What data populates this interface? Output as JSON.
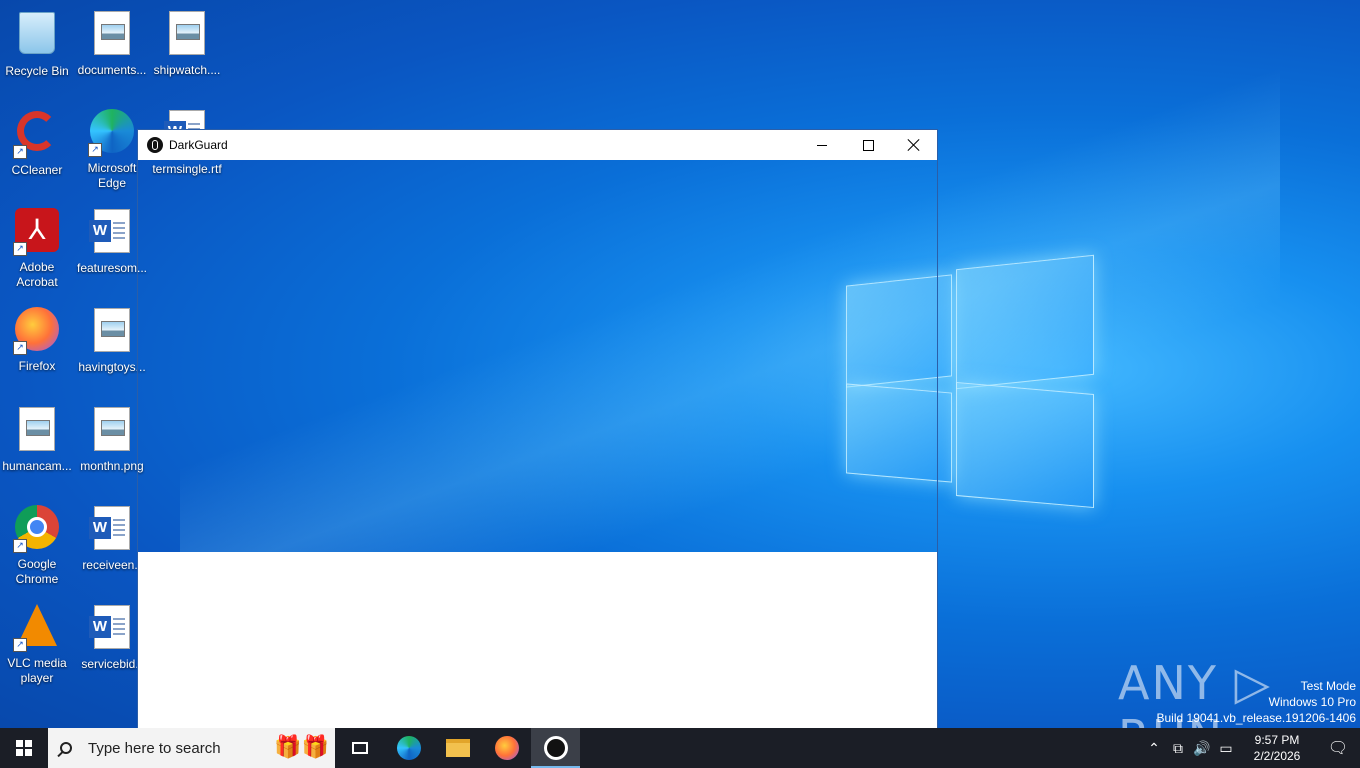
{
  "desktop": {
    "icons": [
      {
        "label": "Recycle Bin"
      },
      {
        "label": "documents..."
      },
      {
        "label": "shipwatch...."
      },
      {
        "label": "CCleaner"
      },
      {
        "label": "Microsoft Edge"
      },
      {
        "label": "termsingle.rtf"
      },
      {
        "label": "Adobe Acrobat"
      },
      {
        "label": "featuresom..."
      },
      {
        "label": "Firefox"
      },
      {
        "label": "havingtoys..."
      },
      {
        "label": "humancam..."
      },
      {
        "label": "monthn.png"
      },
      {
        "label": "Google Chrome"
      },
      {
        "label": "receiveen.r"
      },
      {
        "label": "VLC media player"
      },
      {
        "label": "servicebid.r"
      }
    ]
  },
  "window": {
    "title": "DarkGuard"
  },
  "taskbar": {
    "search_placeholder": "Type here to search",
    "time": "9:57 PM",
    "date": "2/2/2026"
  },
  "watermark": {
    "brand": "ANY ▷ RUN",
    "line1": "Test Mode",
    "line2": "Windows 10 Pro",
    "line3": "Build 19041.vb_release.191206-1406"
  }
}
